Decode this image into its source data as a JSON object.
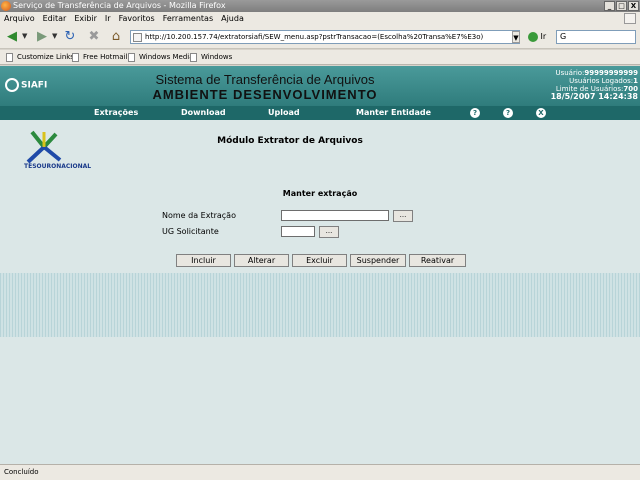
{
  "window": {
    "title": "Serviço de Transferência de Arquivos - Mozilla Firefox",
    "controls": [
      "_",
      "□",
      "X"
    ]
  },
  "menubar": {
    "items": [
      "Arquivo",
      "Editar",
      "Exibir",
      "Ir",
      "Favoritos",
      "Ferramentas",
      "Ajuda"
    ]
  },
  "navbar": {
    "url": "http://10.200.157.74/extratorsiafi/SEW_menu.asp?pstrTransacao=(Escolha%20Transa%E7%E3o)",
    "go_label": "Ir",
    "search_value": "G"
  },
  "bookmarks": {
    "items": [
      "Customize Links",
      "Free Hotmail",
      "Windows Media",
      "Windows"
    ]
  },
  "app": {
    "logo": "SIAFI",
    "title_line1": "Sistema de Transferência de Arquivos",
    "title_line2": "AMBIENTE DESENVOLVIMENTO",
    "user": {
      "usuario_label": "Usuário:",
      "usuario_value": "99999999999",
      "logados_label": "Usuários Logados:",
      "logados_value": "1",
      "limite_label": "Limite de Usuários:",
      "limite_value": "700",
      "datetime": "18/5/2007 14:24:38"
    },
    "menu": [
      "Extrações",
      "Download",
      "Upload",
      "Manter Entidade"
    ],
    "menu_icons": [
      "?",
      "?",
      "X"
    ],
    "tesouro_logo": "TESOURONACIONAL",
    "module_title": "Módulo Extrator de Arquivos"
  },
  "form": {
    "title": "Manter extração",
    "fields": [
      {
        "label": "Nome da Extração",
        "value": ""
      },
      {
        "label": "UG Solicitante",
        "value": ""
      }
    ],
    "lookup_label": "...",
    "buttons": [
      "Incluir",
      "Alterar",
      "Excluir",
      "Suspender",
      "Reativar"
    ]
  },
  "status": {
    "text": "Concluído"
  }
}
